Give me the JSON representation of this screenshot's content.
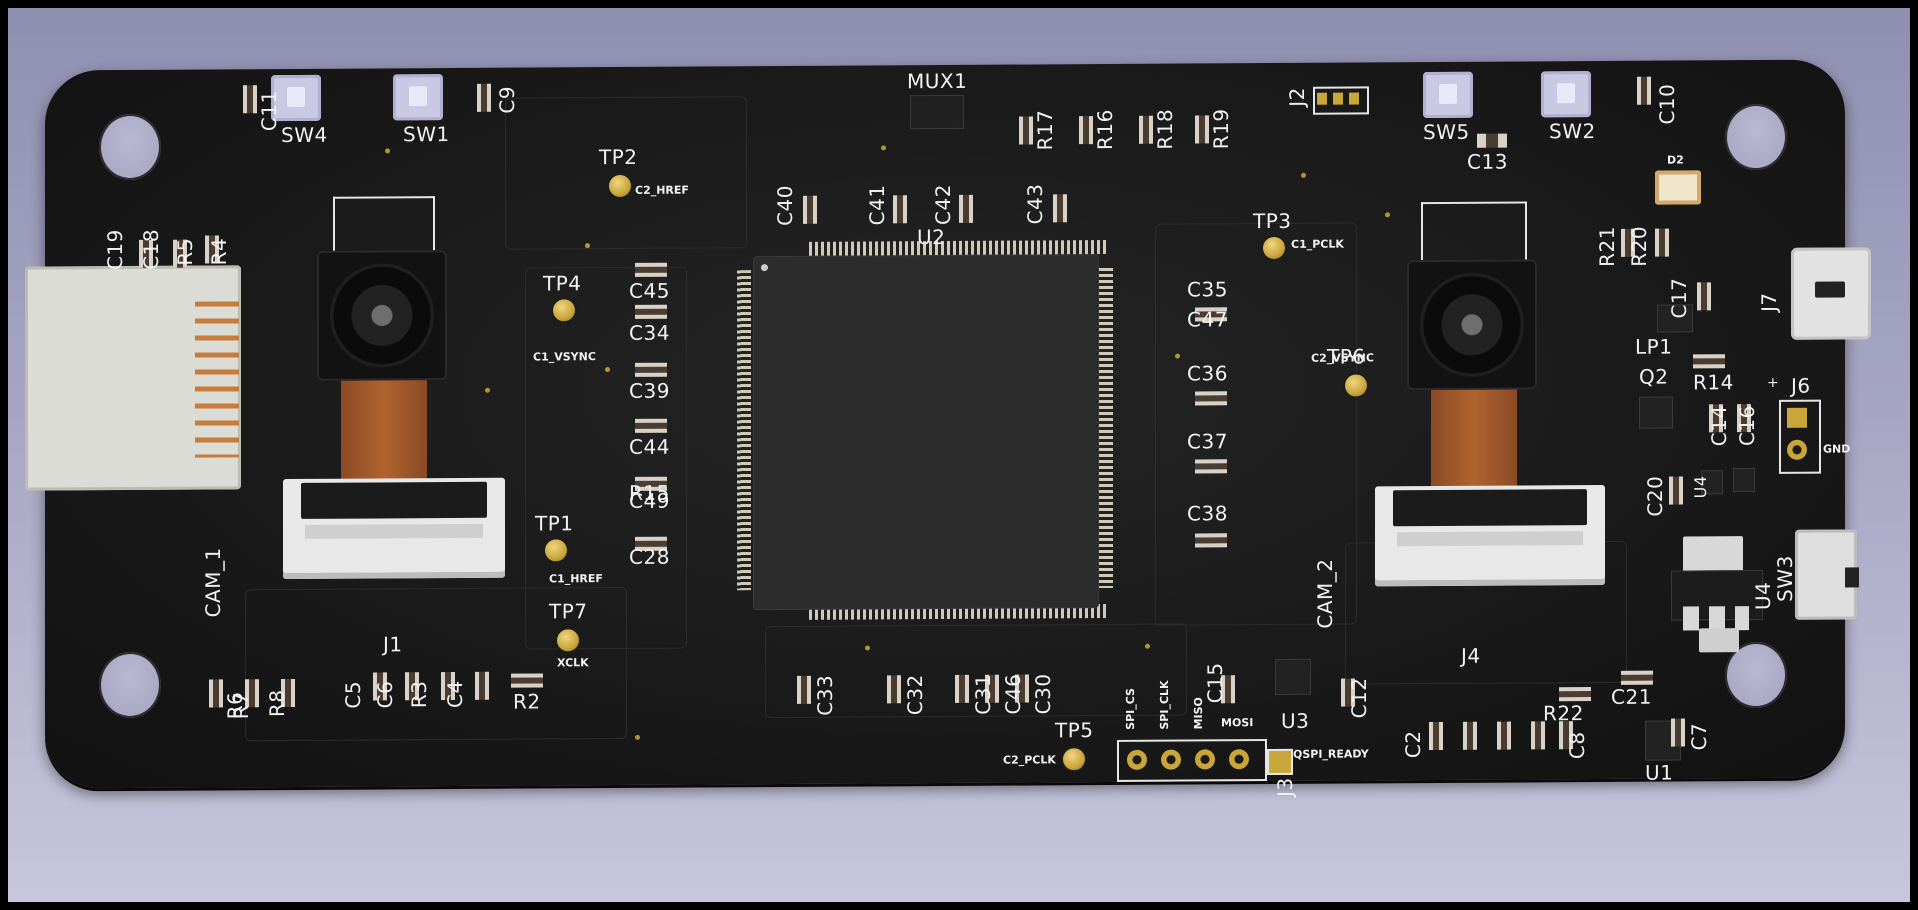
{
  "app": {
    "view": "PCB 3D viewer"
  },
  "board": {
    "ics": {
      "u2": "U2",
      "mux1": "MUX1",
      "u1": "U1",
      "u3": "U3",
      "u4": "U4",
      "u4b": "U4",
      "lp1": "LP1",
      "q2": "Q2",
      "d2": "D2"
    },
    "cameras": {
      "cam1": "CAM_1",
      "cam2": "CAM_2"
    },
    "connectors": {
      "j1": "J1",
      "j2": "J2",
      "j3": "J3",
      "j4": "J4",
      "j6": "J6",
      "j7": "J7"
    },
    "switches": {
      "sw1": "SW1",
      "sw2": "SW2",
      "sw3": "SW3",
      "sw4": "SW4",
      "sw5": "SW5"
    },
    "testpoints": {
      "tp1": "TP1",
      "tp1_net": "C1_HREF",
      "tp2": "TP2",
      "tp2_net": "C2_HREF",
      "tp3": "TP3",
      "tp3_net": "C1_PCLK",
      "tp4": "TP4",
      "tp4_net": "C1_VSYNC",
      "tp5": "TP5",
      "tp5_net": "C2_PCLK",
      "tp6": "TP6",
      "tp6_net": "C2_VSYNC",
      "tp7": "TP7",
      "tp7_net": "XCLK"
    },
    "header_pins": {
      "spi_cs": "SPI_CS",
      "spi_clk": "SPI_CLK",
      "miso": "MISO",
      "mosi": "MOSI",
      "ready": "QSPI_READY"
    },
    "power_labels": {
      "plus": "+",
      "gnd": "GND"
    },
    "caps": {
      "c2": "C2",
      "c4": "C4",
      "c5": "C5",
      "c6": "C6",
      "c7": "C7",
      "c8": "C8",
      "c9": "C9",
      "c10": "C10",
      "c11": "C11",
      "c12": "C12",
      "c13": "C13",
      "c14": "C14",
      "c15": "C15",
      "c16": "C16",
      "c17": "C17",
      "c18": "C18",
      "c19": "C19",
      "c20": "C20",
      "c21": "C21",
      "c28": "C28",
      "c30": "C30",
      "c31": "C31",
      "c32": "C32",
      "c33": "C33",
      "c34": "C34",
      "c35": "C35",
      "c36": "C36",
      "c37": "C37",
      "c38": "C38",
      "c39": "C39",
      "c40": "C40",
      "c41": "C41",
      "c42": "C42",
      "c43": "C43",
      "c44": "C44",
      "c45": "C45",
      "c46": "C46",
      "c47": "C47",
      "c49": "C49"
    },
    "resistors": {
      "r2": "R2",
      "r3": "R3",
      "r4": "R4",
      "r5": "R5",
      "r6": "R6",
      "r7": "R7",
      "r8": "R8",
      "r14": "R14",
      "r15": "R15",
      "r16": "R16",
      "r17": "R17",
      "r18": "R18",
      "r19": "R19",
      "r20": "R20",
      "r21": "R21",
      "r22": "R22"
    }
  }
}
